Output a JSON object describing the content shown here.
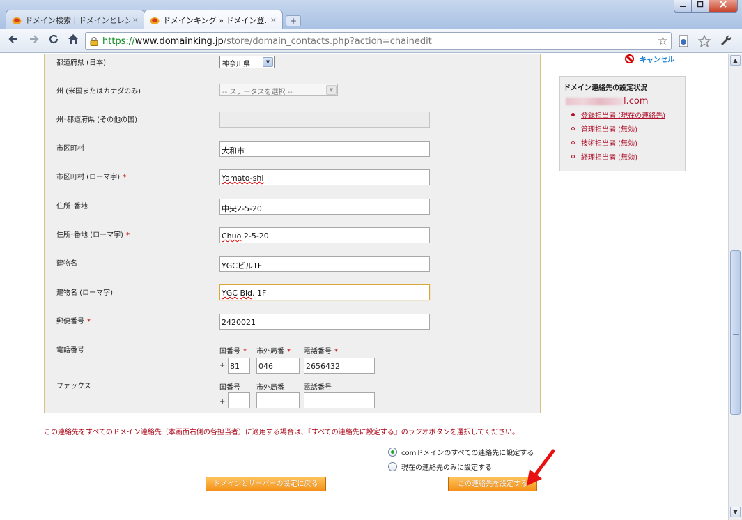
{
  "window": {
    "tabs": [
      {
        "title": "ドメイン検索 | ドメインとレン…",
        "active": false
      },
      {
        "title": "ドメインキング » ドメイン登…",
        "active": true
      }
    ],
    "close_glyph": "×",
    "new_tab_glyph": "+"
  },
  "address_bar": {
    "scheme": "https://",
    "host": "www.domainking.jp",
    "path": "/store/domain_contacts.php?action=chainedit"
  },
  "form": {
    "prefecture_jp": {
      "label": "都道府県 (日本)",
      "value": "神奈川県"
    },
    "state_us_ca": {
      "label": "州 (米国またはカナダのみ)",
      "value": "-- ステータスを選択 --"
    },
    "state_other": {
      "label": "州･都道府県 (その他の国)",
      "value": ""
    },
    "city": {
      "label": "市区町村",
      "value": "大和市"
    },
    "city_roman": {
      "label": "市区町村 (ローマ字)",
      "required": "*",
      "value": "Yamato-shi"
    },
    "address": {
      "label": "住所･番地",
      "value": "中央2-5-20"
    },
    "address_roman": {
      "label": "住所･番地 (ローマ字)",
      "required": "*",
      "value_word": "Chuo",
      "value_rest": " 2-5-20"
    },
    "building": {
      "label": "建物名",
      "value": "YGCビル1F"
    },
    "building_roman": {
      "label": "建物名 (ローマ字)",
      "value_w1": "YGC",
      "value_mid": " ",
      "value_w2": "Bld",
      "value_rest": ". 1F"
    },
    "postal": {
      "label": "郵便番号",
      "required": "*",
      "value": "2420021"
    },
    "phone": {
      "label": "電話番号",
      "country_label": "国番号",
      "area_label": "市外局番",
      "number_label": "電話番号",
      "required": "*",
      "plus": "+",
      "country": "81",
      "area": "046",
      "number": "2656432"
    },
    "fax": {
      "label": "ファックス",
      "country_label": "国番号",
      "area_label": "市外局番",
      "number_label": "電話番号",
      "plus": "+",
      "country": "",
      "area": "",
      "number": ""
    }
  },
  "sidebar": {
    "cancel_label": "キャンセル",
    "status_title": "ドメイン連絡先の設定状況",
    "email_suffix": "l.com",
    "items": [
      {
        "label": "登録担当者 (現在の連絡先)",
        "current": true
      },
      {
        "label": "管理担当者 (無効)",
        "current": false
      },
      {
        "label": "技術担当者 (無効)",
        "current": false
      },
      {
        "label": "経理担当者 (無効)",
        "current": false
      }
    ]
  },
  "bottom": {
    "notice": "この連絡先をすべてのドメイン連絡先（本画面右側の各担当者）に適用する場合は、『すべての連絡先に設定する』のラジオボタンを選択してください。",
    "radio_all": "comドメインのすべての連絡先に設定する",
    "radio_current": "現在の連絡先のみに設定する",
    "back_button": "ドメインとサーバーの設定に戻る",
    "submit_button": "この連絡先を設定する"
  },
  "colors": {
    "accent_orange": "#f49118",
    "required_red": "#cc0000",
    "status_red": "#b0102a",
    "panel_border": "#d8c27a"
  }
}
